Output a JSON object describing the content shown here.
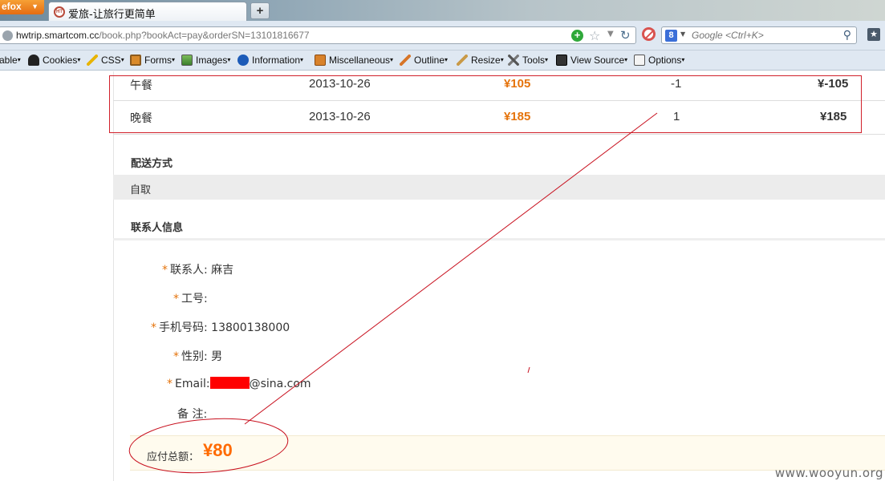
{
  "browser": {
    "menu_button": "efox",
    "tab_title": "爱旅-让旅行更简单",
    "favicon_text": "HT",
    "newtab_label": "+",
    "url_host": "hwtrip.smartcom.cc",
    "url_path": "/book.php?bookAct=pay&orderSN=13101816677",
    "search_placeholder": "Google <Ctrl+K>",
    "search_engine_letter": "8"
  },
  "devtoolbar": {
    "items": [
      {
        "label": "able",
        "icon": "disable-icon"
      },
      {
        "label": "Cookies",
        "icon": "cookies-icon"
      },
      {
        "label": "CSS",
        "icon": "css-icon"
      },
      {
        "label": "Forms",
        "icon": "forms-icon"
      },
      {
        "label": "Images",
        "icon": "images-icon"
      },
      {
        "label": "Information",
        "icon": "information-icon"
      },
      {
        "label": "Miscellaneous",
        "icon": "miscellaneous-icon"
      },
      {
        "label": "Outline",
        "icon": "outline-icon"
      },
      {
        "label": "Resize",
        "icon": "resize-icon"
      },
      {
        "label": "Tools",
        "icon": "tools-icon"
      },
      {
        "label": "View Source",
        "icon": "view-source-icon"
      },
      {
        "label": "Options",
        "icon": "options-icon"
      }
    ]
  },
  "order_items": [
    {
      "name": "午餐",
      "date": "2013-10-26",
      "price": "¥105",
      "quantity": "-1",
      "total": "¥-105"
    },
    {
      "name": "晚餐",
      "date": "2013-10-26",
      "price": "¥185",
      "quantity": "1",
      "total": "¥185"
    }
  ],
  "delivery": {
    "title": "配送方式",
    "value": "自取"
  },
  "contact": {
    "title": "联系人信息",
    "required_mark": "*",
    "fields": [
      {
        "label": "联系人:",
        "value": "麻吉",
        "required": true
      },
      {
        "label": "工号:",
        "value": "",
        "required": true
      },
      {
        "label": "手机号码:",
        "value": "13800138000",
        "required": true
      },
      {
        "label": "性别:",
        "value": "男",
        "required": true
      },
      {
        "label": "Email:",
        "value": "@sina.com",
        "required": true
      },
      {
        "label": "备 注:",
        "value": "",
        "required": false
      }
    ]
  },
  "payment": {
    "label": "应付总额：",
    "amount": "¥80"
  },
  "watermark": "www.wooyun.org",
  "colors": {
    "accent_orange": "#e5730b",
    "total_orange": "#ff6a00",
    "annotation_red": "#c8101e",
    "redaction": "#ff0000"
  }
}
